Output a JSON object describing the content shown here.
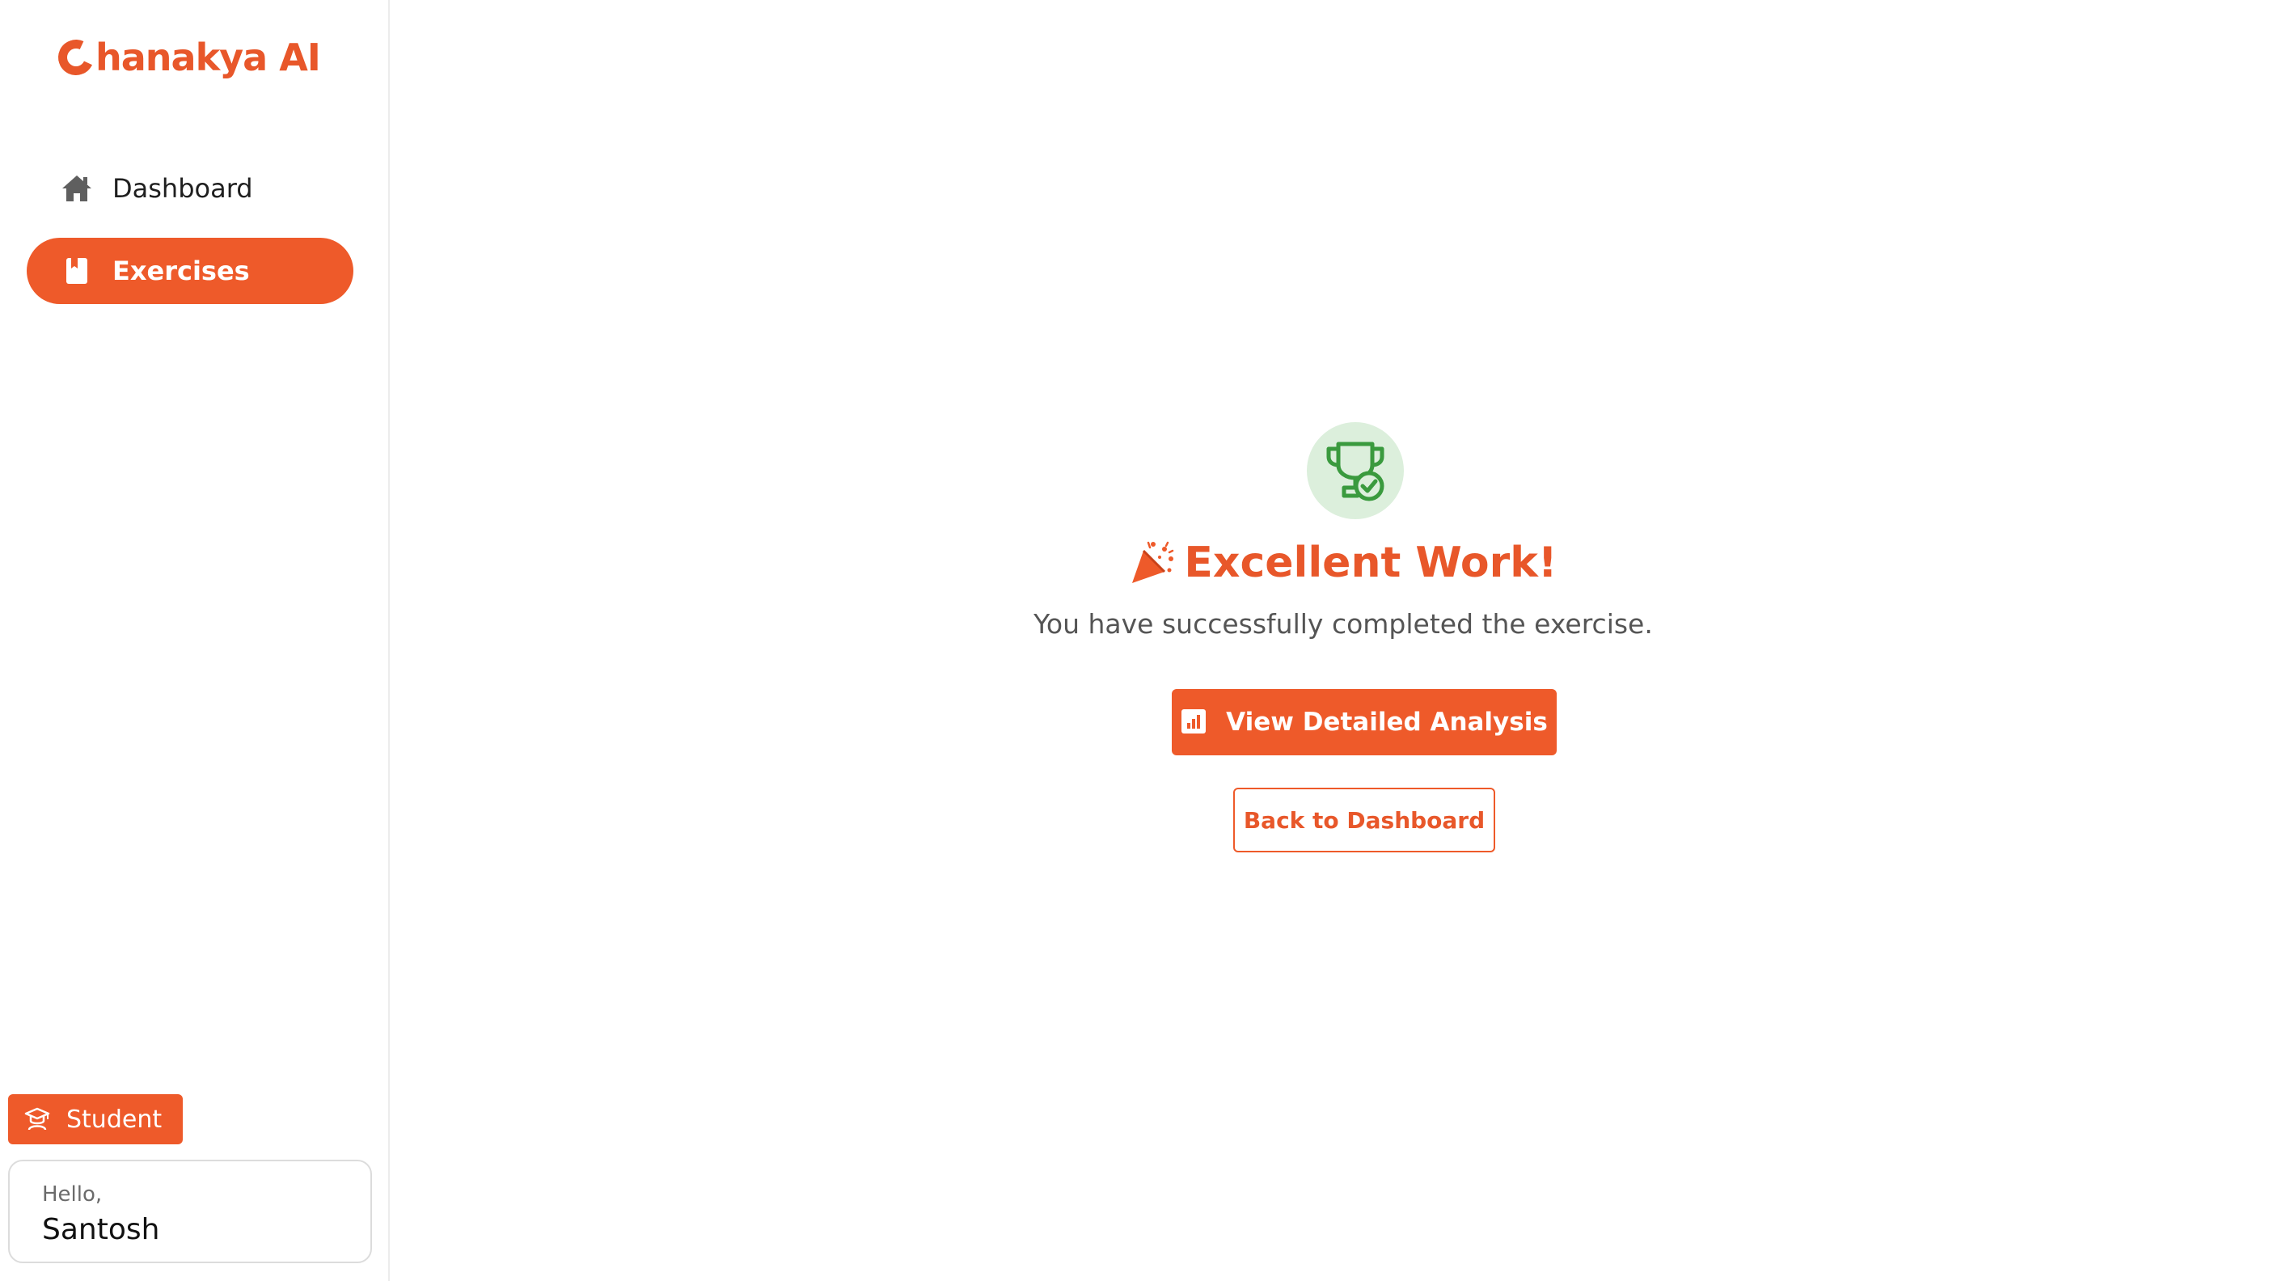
{
  "brand": {
    "name": "hanakya AI",
    "color": "#e8572a"
  },
  "sidebar": {
    "items": [
      {
        "label": "Dashboard",
        "icon": "home-icon",
        "active": false
      },
      {
        "label": "Exercises",
        "icon": "book-icon",
        "active": true
      }
    ],
    "role": {
      "label": "Student",
      "icon": "student-icon"
    },
    "user": {
      "greeting": "Hello,",
      "name": "Santosh"
    }
  },
  "main": {
    "icon": "trophy-check-icon",
    "headline": "Excellent Work!",
    "headline_icon": "party-popper-icon",
    "subtitle": "You have successfully completed the exercise.",
    "primary_button": {
      "label": "View Detailed Analysis",
      "icon": "chart-icon"
    },
    "secondary_button": {
      "label": "Back to Dashboard"
    }
  },
  "colors": {
    "accent": "#ee5a2a",
    "success": "#3a9a3e",
    "success_bg": "#dcefdc"
  }
}
